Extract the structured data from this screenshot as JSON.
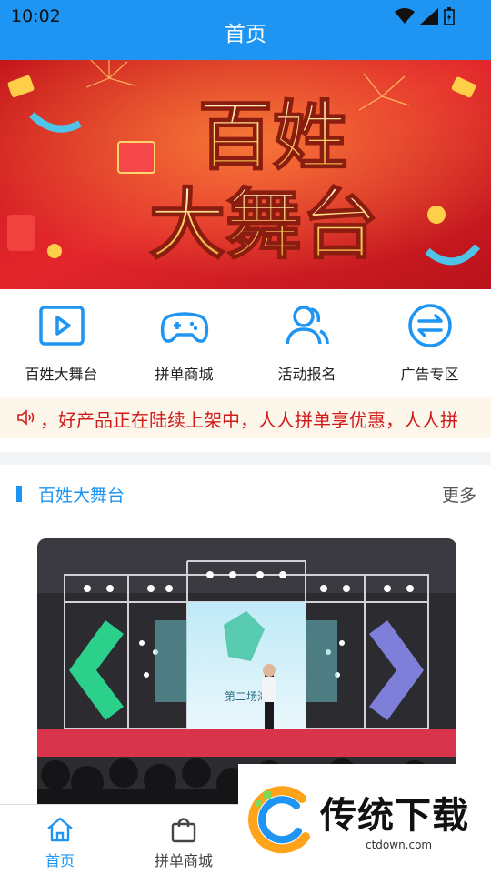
{
  "status": {
    "time": "10:02"
  },
  "header": {
    "title": "首页"
  },
  "banner": {
    "line1": "百姓",
    "line2": "大舞台"
  },
  "quick_links": [
    {
      "label": "百姓大舞台",
      "icon": "play-icon"
    },
    {
      "label": "拼单商城",
      "icon": "gamepad-icon"
    },
    {
      "label": "活动报名",
      "icon": "users-icon"
    },
    {
      "label": "广告专区",
      "icon": "swap-icon"
    }
  ],
  "notice": {
    "text": "，好产品正在陆续上架中，人人拼单享优惠，人人拼"
  },
  "section": {
    "title": "百姓大舞台",
    "more": "更多"
  },
  "photo": {
    "sign": "第二场海"
  },
  "tabs": [
    {
      "label": "首页",
      "active": true
    },
    {
      "label": "拼单商城",
      "active": false
    }
  ],
  "watermark": {
    "brand": "传统下载",
    "url": "ctdown.com"
  },
  "colors": {
    "primary": "#1e95f3",
    "notice": "#d11b1b"
  }
}
